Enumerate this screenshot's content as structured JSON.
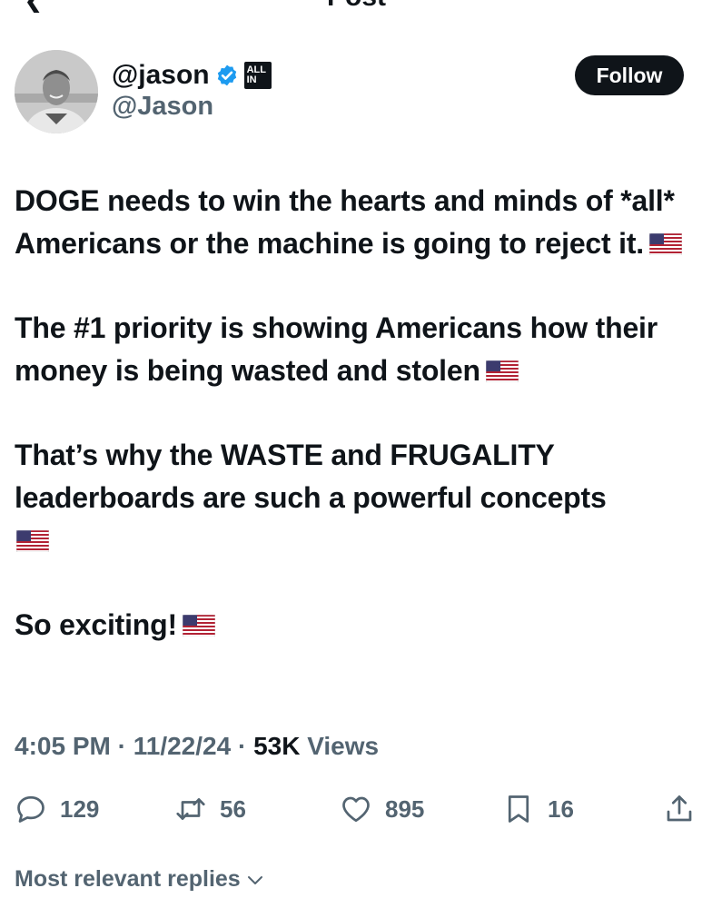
{
  "header": {
    "title": "Post"
  },
  "author": {
    "display_name": "@jason",
    "handle": "@Jason",
    "affiliation_badge": [
      "ALL",
      "IN"
    ]
  },
  "follow_label": "Follow",
  "tweet": {
    "paragraphs": [
      "DOGE needs to win the hearts and minds of *all* Americans or the machine is going to reject it.",
      "The #1 priority is showing Americans how their money is being wasted and stolen",
      "That’s why the WASTE and FRUGALITY leaderboards are such a powerful concepts",
      "So exciting!"
    ]
  },
  "meta": {
    "time": "4:05 PM",
    "date": "11/22/24",
    "views_count": "53K",
    "views_label": "Views"
  },
  "actions": {
    "replies": "129",
    "reposts": "56",
    "likes": "895",
    "bookmarks": "16"
  },
  "replies_sort": "Most relevant replies",
  "icons": {
    "back": "back-arrow-icon",
    "verified": "verified-badge-icon",
    "reply": "reply-icon",
    "repost": "repost-icon",
    "like": "heart-icon",
    "bookmark": "bookmark-icon",
    "share": "share-icon",
    "sort": "chevron-down-icon"
  },
  "colors": {
    "text": "#0f1419",
    "secondary": "#536471",
    "verified": "#1d9bf0",
    "button": "#0f1419"
  }
}
